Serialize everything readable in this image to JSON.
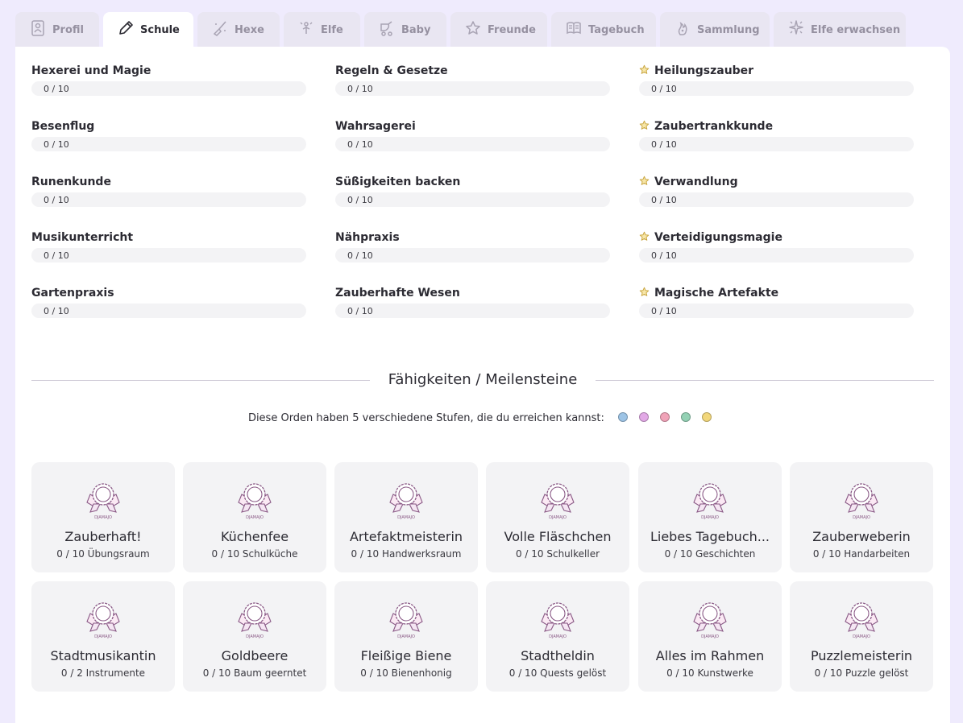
{
  "tabs": [
    {
      "label": "Profil",
      "icon": "profile-icon"
    },
    {
      "label": "Schule",
      "icon": "pencil-icon",
      "active": true
    },
    {
      "label": "Hexe",
      "icon": "broom-icon"
    },
    {
      "label": "Elfe",
      "icon": "fairy-icon"
    },
    {
      "label": "Baby",
      "icon": "baby-carriage-icon"
    },
    {
      "label": "Freunde",
      "icon": "star-icon"
    },
    {
      "label": "Tagebuch",
      "icon": "book-icon"
    },
    {
      "label": "Sammlung",
      "icon": "collection-icon"
    },
    {
      "label": "Elfe erwachsen",
      "icon": "sparkle-icon"
    }
  ],
  "skills": {
    "col1": [
      {
        "name": "Hexerei und Magie",
        "progress": "0 / 10",
        "fraction": 0
      },
      {
        "name": "Besenflug",
        "progress": "0 / 10",
        "fraction": 0
      },
      {
        "name": "Runenkunde",
        "progress": "0 / 10",
        "fraction": 0
      },
      {
        "name": "Musikunterricht",
        "progress": "0 / 10",
        "fraction": 0
      },
      {
        "name": "Gartenpraxis",
        "progress": "0 / 10",
        "fraction": 0
      }
    ],
    "col2": [
      {
        "name": "Regeln & Gesetze",
        "progress": "0 / 10",
        "fraction": 0
      },
      {
        "name": "Wahrsagerei",
        "progress": "0 / 10",
        "fraction": 0
      },
      {
        "name": "Süßigkeiten backen",
        "progress": "0 / 10",
        "fraction": 0
      },
      {
        "name": "Nähpraxis",
        "progress": "0 / 10",
        "fraction": 0
      },
      {
        "name": "Zauberhafte Wesen",
        "progress": "0 / 10",
        "fraction": 0
      }
    ],
    "col3": [
      {
        "name": "Heilungszauber",
        "progress": "0 / 10",
        "fraction": 0
      },
      {
        "name": "Zaubertrankkunde",
        "progress": "0 / 10",
        "fraction": 0
      },
      {
        "name": "Verwandlung",
        "progress": "0 / 10",
        "fraction": 0
      },
      {
        "name": "Verteidigungsmagie",
        "progress": "0 / 10",
        "fraction": 0
      },
      {
        "name": "Magische Artefakte",
        "progress": "0 / 10",
        "fraction": 0
      }
    ]
  },
  "milestones": {
    "title": "Fähigkeiten / Meilensteine",
    "levels_text": "Diese Orden haben 5 verschiedene Stufen, die du erreichen kannst:",
    "level_colors": [
      "#9dc4e6",
      "#e2a9e6",
      "#f0a3b8",
      "#93d1b4",
      "#f2d77b"
    ],
    "badge_label": "DJAMAJO",
    "cards": [
      {
        "title": "Zauberhaft!",
        "sub": "0 / 10 Übungsraum"
      },
      {
        "title": "Küchenfee",
        "sub": "0 / 10 Schulküche"
      },
      {
        "title": "Artefaktmeisterin",
        "sub": "0 / 10 Handwerksraum"
      },
      {
        "title": "Volle Fläschchen",
        "sub": "0 / 10 Schulkeller"
      },
      {
        "title": "Liebes Tagebuch...",
        "sub": "0 / 10 Geschichten"
      },
      {
        "title": "Zauberweberin",
        "sub": "0 / 10 Handarbeiten"
      },
      {
        "title": "Stadtmusikantin",
        "sub": "0 / 2 Instrumente"
      },
      {
        "title": "Goldbeere",
        "sub": "0 / 10 Baum geerntet"
      },
      {
        "title": "Fleißige Biene",
        "sub": "0 / 10 Bienenhonig"
      },
      {
        "title": "Stadtheldin",
        "sub": "0 / 10 Quests gelöst"
      },
      {
        "title": "Alles im Rahmen",
        "sub": "0 / 10 Kunstwerke"
      },
      {
        "title": "Puzzlemeisterin",
        "sub": "0 / 10 Puzzle gelöst"
      }
    ]
  }
}
